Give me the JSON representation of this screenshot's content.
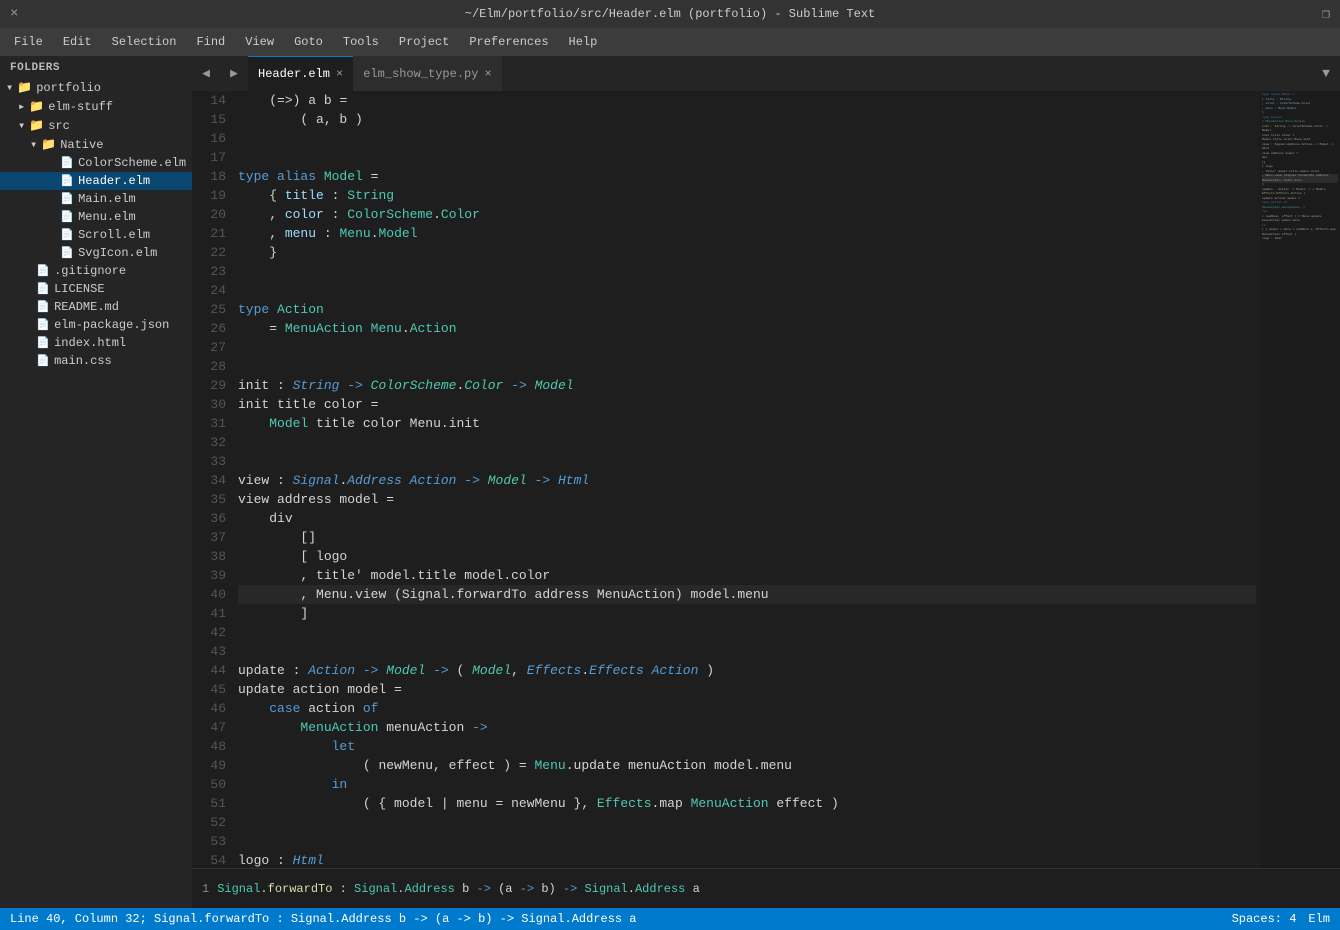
{
  "titlebar": {
    "close": "×",
    "title": "~/Elm/portfolio/src/Header.elm (portfolio) - Sublime Text",
    "restore": "❐"
  },
  "menubar": {
    "items": [
      "File",
      "Edit",
      "Selection",
      "Find",
      "View",
      "Goto",
      "Tools",
      "Project",
      "Preferences",
      "Help"
    ]
  },
  "sidebar": {
    "header": "FOLDERS",
    "tree": [
      {
        "indent": 0,
        "type": "folder",
        "open": true,
        "label": "portfolio"
      },
      {
        "indent": 1,
        "type": "folder",
        "open": false,
        "label": "elm-stuff"
      },
      {
        "indent": 1,
        "type": "folder",
        "open": true,
        "label": "src"
      },
      {
        "indent": 2,
        "type": "folder",
        "open": true,
        "label": "Native"
      },
      {
        "indent": 3,
        "type": "file",
        "label": "ColorScheme.elm"
      },
      {
        "indent": 3,
        "type": "file",
        "label": "Header.elm",
        "selected": true
      },
      {
        "indent": 3,
        "type": "file",
        "label": "Main.elm"
      },
      {
        "indent": 3,
        "type": "file",
        "label": "Menu.elm"
      },
      {
        "indent": 3,
        "type": "file",
        "label": "Scroll.elm"
      },
      {
        "indent": 3,
        "type": "file",
        "label": "SvgIcon.elm"
      },
      {
        "indent": 1,
        "type": "file",
        "label": ".gitignore"
      },
      {
        "indent": 1,
        "type": "file",
        "label": "LICENSE"
      },
      {
        "indent": 1,
        "type": "file",
        "label": "README.md"
      },
      {
        "indent": 1,
        "type": "file",
        "label": "elm-package.json"
      },
      {
        "indent": 1,
        "type": "file",
        "label": "index.html"
      },
      {
        "indent": 1,
        "type": "file",
        "label": "main.css"
      }
    ]
  },
  "tabs": [
    {
      "label": "Header.elm",
      "active": true
    },
    {
      "label": "elm_show_type.py",
      "active": false
    }
  ],
  "statusbar": {
    "left": "Line 40, Column 32; Signal.forwardTo : Signal.Address b -> (a -> b) -> Signal.Address a",
    "right_spaces": "Spaces: 4",
    "right_lang": "Elm"
  },
  "bottom_panel": {
    "text": "Signal.forwardTo : Signal.Address b -> (a -> b) -> Signal.Address a",
    "line_num": "1"
  }
}
